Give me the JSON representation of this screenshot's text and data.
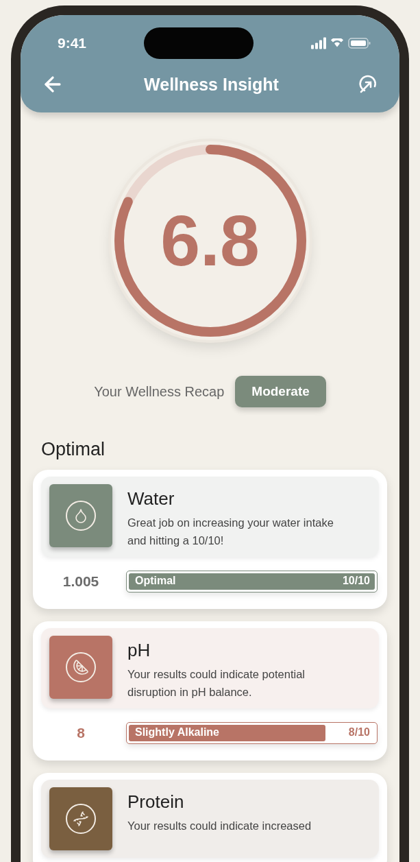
{
  "status_bar": {
    "time": "9:41"
  },
  "header": {
    "title": "Wellness Insight"
  },
  "score": {
    "value": "6.8",
    "level": 0.82
  },
  "recap": {
    "label": "Your Wellness Recap",
    "badge": "Moderate"
  },
  "section_title": "Optimal",
  "metrics": [
    {
      "kind": "water",
      "title": "Water",
      "description": "Great job on increasing your water intake and hitting a 10/10!",
      "reading": "1.005",
      "bar_label": "Optimal",
      "bar_score": "10/10",
      "level": 1.0,
      "color": "#7b8b7c"
    },
    {
      "kind": "ph",
      "title": "pH",
      "description": "Your results could indicate potential disruption in pH balance.",
      "reading": "8",
      "bar_label": "Slightly Alkaline",
      "bar_score": "8/10",
      "level": 0.8,
      "color": "#b87466"
    },
    {
      "kind": "protein",
      "title": "Protein",
      "description": "Your results could indicate increased",
      "color": "#7a5f40"
    }
  ]
}
